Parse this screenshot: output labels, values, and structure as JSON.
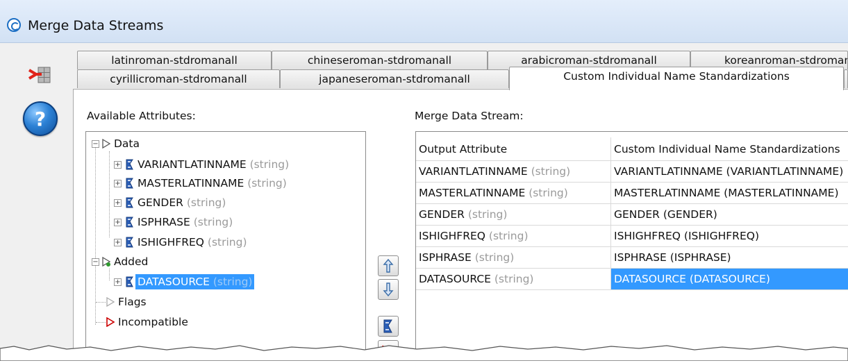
{
  "window": {
    "title": "Merge Data Streams"
  },
  "tabs": {
    "row1": [
      "latinroman-stdromanall",
      "chineseroman-stdromanall",
      "arabicroman-stdromanall",
      "koreanroman-stdromanall"
    ],
    "row2": [
      "cyrillicroman-stdromanall",
      "japaneseroman-stdromanall",
      "Custom Individual Name Standardizations"
    ],
    "active": "Custom Individual Name Standardizations"
  },
  "available": {
    "label": "Available Attributes:",
    "groups": {
      "data": "Data",
      "added": "Added",
      "flags": "Flags",
      "incompatible": "Incompatible"
    },
    "data_items": [
      {
        "name": "VARIANTLATINNAME",
        "type": "(string)"
      },
      {
        "name": "MASTERLATINNAME",
        "type": "(string)"
      },
      {
        "name": "GENDER",
        "type": "(string)"
      },
      {
        "name": "ISPHRASE",
        "type": "(string)"
      },
      {
        "name": "ISHIGHFREQ",
        "type": "(string)"
      }
    ],
    "added_items": [
      {
        "name": "DATASOURCE",
        "type": "(string)",
        "selected": true
      }
    ]
  },
  "merge": {
    "label": "Merge Data Stream:",
    "columns": [
      "Output Attribute",
      "Custom Individual Name Standardizations"
    ],
    "rows": [
      {
        "attr": "VARIANTLATINNAME",
        "type": "(string)",
        "value": "VARIANTLATINNAME (VARIANTLATINNAME)"
      },
      {
        "attr": "MASTERLATINNAME",
        "type": "(string)",
        "value": "MASTERLATINNAME (MASTERLATINNAME)"
      },
      {
        "attr": "GENDER",
        "type": "(string)",
        "value": "GENDER (GENDER)"
      },
      {
        "attr": "ISHIGHFREQ",
        "type": "(string)",
        "value": "ISHIGHFREQ (ISHIGHFREQ)"
      },
      {
        "attr": "ISPHRASE",
        "type": "(string)",
        "value": "ISPHRASE (ISPHRASE)"
      },
      {
        "attr": "DATASOURCE",
        "type": "(string)",
        "value": "DATASOURCE (DATASOURCE)",
        "selected": true
      }
    ]
  },
  "icons": {
    "title": "app-logo-icon",
    "merge": "merge-streams-icon",
    "help": "help-icon",
    "up": "arrow-up-icon",
    "down": "arrow-down-icon",
    "attribute": "attribute-icon",
    "remove": "remove-icon"
  },
  "colors": {
    "selection": "#3399ff",
    "type_hint": "#9a9a9a",
    "title_bar": "#d2e1f4",
    "incompatible": "#cc0000",
    "added": "#2e9a2e"
  }
}
